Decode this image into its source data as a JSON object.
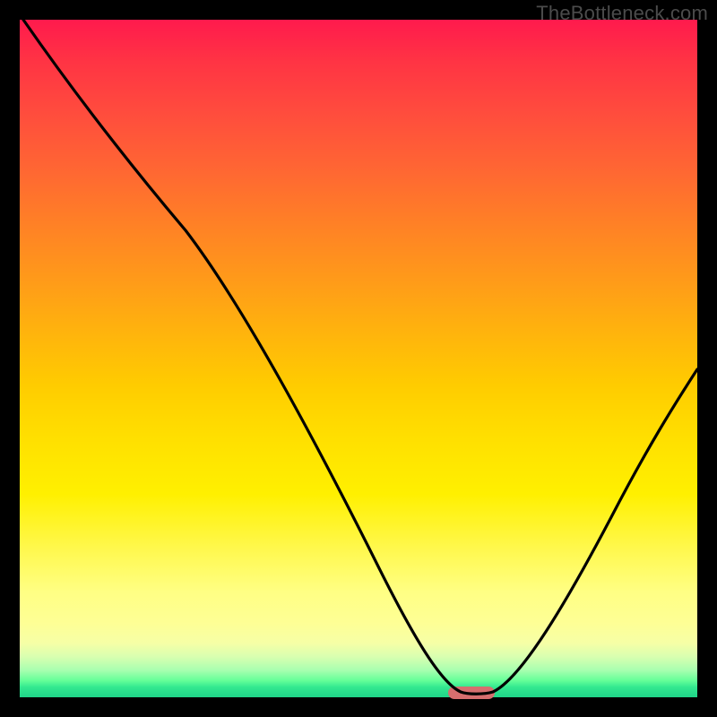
{
  "watermark": "TheBottleneck.com",
  "chart_data": {
    "type": "line",
    "title": "",
    "xlabel": "",
    "ylabel": "",
    "xlim": [
      0,
      100
    ],
    "ylim": [
      0,
      100
    ],
    "x": [
      0,
      10,
      20,
      30,
      40,
      50,
      58,
      63,
      67,
      72,
      80,
      90,
      100
    ],
    "values": [
      100,
      88,
      76,
      60,
      42,
      24,
      8,
      1,
      0,
      1,
      12,
      30,
      49
    ],
    "optimum_marker": {
      "x": 66,
      "width": 6,
      "color": "#d96b6b"
    },
    "curve_color": "#000000",
    "background_gradient": [
      "#ff1a4d",
      "#ffcc00",
      "#ffff84",
      "#1fd588"
    ]
  }
}
